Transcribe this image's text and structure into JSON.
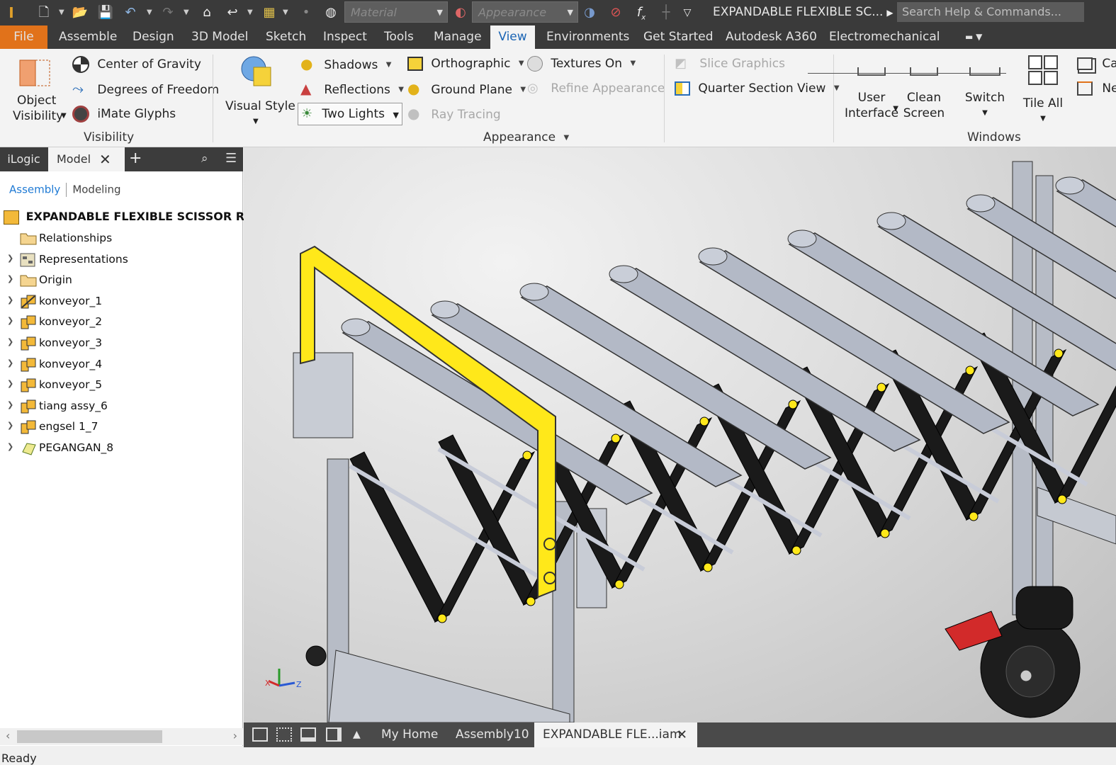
{
  "quick_access": {
    "material_placeholder": "Material",
    "appearance_placeholder": "Appearance",
    "title": "EXPANDABLE FLEXIBLE SC...",
    "search_placeholder": "Search Help & Commands..."
  },
  "ribbon_tabs": [
    "File",
    "Assemble",
    "Design",
    "3D Model",
    "Sketch",
    "Inspect",
    "Tools",
    "Manage",
    "View",
    "Environments",
    "Get Started",
    "Autodesk A360",
    "Electromechanical"
  ],
  "active_tab": "View",
  "ribbon": {
    "visibility": {
      "object_visibility_1": "Object",
      "object_visibility_2": "Visibility",
      "center_of_gravity": "Center of Gravity",
      "degrees_of_freedom": "Degrees of Freedom",
      "imate_glyphs": "iMate Glyphs",
      "group_label": "Visibility"
    },
    "appearance": {
      "visual_style": "Visual Style",
      "shadows": "Shadows",
      "reflections": "Reflections",
      "lighting": "Two Lights",
      "orthographic": "Orthographic",
      "ground_plane": "Ground Plane",
      "ray_tracing": "Ray Tracing",
      "textures_on": "Textures On",
      "refine_appearance": "Refine Appearance",
      "slice_graphics": "Slice Graphics",
      "quarter_section_view": "Quarter Section View",
      "group_label": "Appearance"
    },
    "windows": {
      "user_interface_1": "User",
      "user_interface_2": "Interface",
      "clean_screen_1": "Clean",
      "clean_screen_2": "Screen",
      "switch": "Switch",
      "tile_all": "Tile All",
      "cascade_partial": "Ca",
      "new_partial": "Ne",
      "group_label": "Windows"
    }
  },
  "browser": {
    "tab_ilogic": "iLogic",
    "tab_model": "Model",
    "link_assembly": "Assembly",
    "link_modeling": "Modeling",
    "root": "EXPANDABLE FLEXIBLE SCISSOR ROLLI",
    "items": [
      {
        "label": "Relationships",
        "icon": "folder"
      },
      {
        "label": "Representations",
        "icon": "representations"
      },
      {
        "label": "Origin",
        "icon": "folder"
      },
      {
        "label": "konveyor_1",
        "icon": "assembly-flexible"
      },
      {
        "label": "konveyor_2",
        "icon": "assembly"
      },
      {
        "label": "konveyor_3",
        "icon": "assembly"
      },
      {
        "label": "konveyor_4",
        "icon": "assembly"
      },
      {
        "label": "konveyor_5",
        "icon": "assembly"
      },
      {
        "label": "tiang assy_6",
        "icon": "assembly"
      },
      {
        "label": "engsel 1_7",
        "icon": "assembly"
      },
      {
        "label": "PEGANGAN_8",
        "icon": "part"
      }
    ]
  },
  "doc_tabs": {
    "my_home": "My Home",
    "assembly10": "Assembly10",
    "active": "EXPANDABLE FLE...iam"
  },
  "status": "Ready",
  "colors": {
    "file_tab": "#e1721a",
    "active_tab_text": "#1a64b4",
    "highlight_yellow": "#ffe81a",
    "link_blue": "#1f7ad4"
  }
}
